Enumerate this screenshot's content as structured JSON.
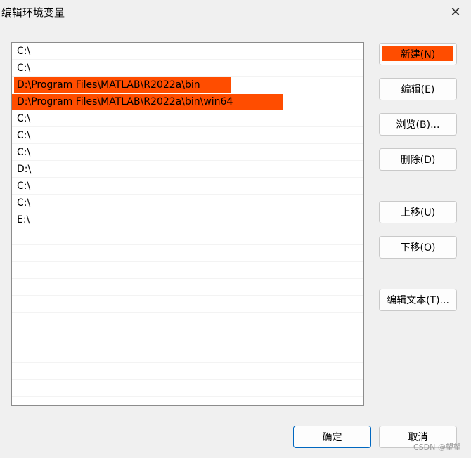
{
  "window": {
    "title": "编辑环境变量",
    "close_symbol": "✕"
  },
  "path_list": {
    "rows": [
      "C:\\",
      "C:\\",
      "D:\\Program Files\\MATLAB\\R2022a\\bin",
      "D:\\Program Files\\MATLAB\\R2022a\\bin\\win64",
      "C:\\",
      "C:\\",
      "C:\\",
      "D:\\",
      "C:\\",
      "C:\\",
      "E:\\",
      "",
      "",
      "",
      "",
      "",
      "",
      "",
      "",
      "",
      ""
    ],
    "highlight_color": "#ff4d00"
  },
  "buttons": {
    "new": "新建(N)",
    "edit": "编辑(E)",
    "browse": "浏览(B)...",
    "delete": "删除(D)",
    "move_up": "上移(U)",
    "move_down": "下移(O)",
    "edit_text": "编辑文本(T)...",
    "ok": "确定",
    "cancel": "取消"
  },
  "watermark": "CSDN @望望"
}
